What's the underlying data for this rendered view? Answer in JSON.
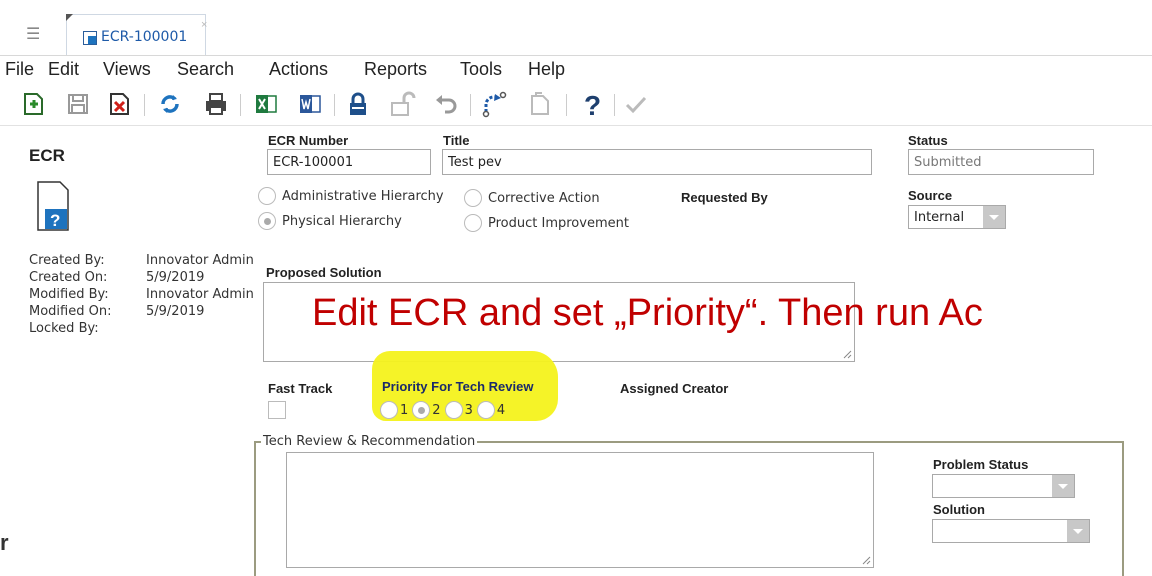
{
  "tab": {
    "label": "ECR-100001",
    "close": "×"
  },
  "menu": [
    "File",
    "Edit",
    "Views",
    "Search",
    "Actions",
    "Reports",
    "Tools",
    "Help"
  ],
  "toolbar": {
    "icons": [
      "new-icon",
      "save-icon",
      "delete-icon",
      "refresh-icon",
      "print-icon",
      "excel-icon",
      "word-icon",
      "lock-icon",
      "unlock-icon",
      "undo-icon",
      "promote-icon",
      "version-icon",
      "help-icon",
      "done-icon"
    ]
  },
  "item": {
    "type": "ECR",
    "meta": [
      {
        "label": "Created By:",
        "value": "Innovator Admin"
      },
      {
        "label": "Created On:",
        "value": "5/9/2019"
      },
      {
        "label": "Modified By:",
        "value": "Innovator Admin"
      },
      {
        "label": "Modified On:",
        "value": "5/9/2019"
      },
      {
        "label": "Locked By:",
        "value": ""
      }
    ]
  },
  "form": {
    "ecr_number_label": "ECR Number",
    "ecr_number": "ECR-100001",
    "title_label": "Title",
    "title": "Test pev",
    "status_label": "Status",
    "status": "Submitted",
    "source_label": "Source",
    "source": "Internal",
    "requested_by_label": "Requested By",
    "hierarchy_options": [
      "Administrative Hierarchy",
      "Physical Hierarchy"
    ],
    "hierarchy_selected": "Physical Hierarchy",
    "type_options": [
      "Corrective Action",
      "Product Improvement"
    ],
    "proposed_solution_label": "Proposed Solution",
    "fast_track_label": "Fast Track",
    "priority_label": "Priority For Tech Review",
    "priority_options": [
      "1",
      "2",
      "3",
      "4"
    ],
    "priority_selected": "2",
    "assigned_creator_label": "Assigned Creator",
    "tech_review_legend": "Tech Review & Recommendation",
    "problem_status_label": "Problem Status",
    "problem_status": "",
    "solution_label": "Solution",
    "solution": ""
  },
  "annotation": "Edit ECR and set „Priority“. Then run Ac",
  "stray_text": "r",
  "colors": {
    "accent": "#1e5aa8",
    "annotation": "#c00000",
    "highlight": "#f4f21c"
  }
}
